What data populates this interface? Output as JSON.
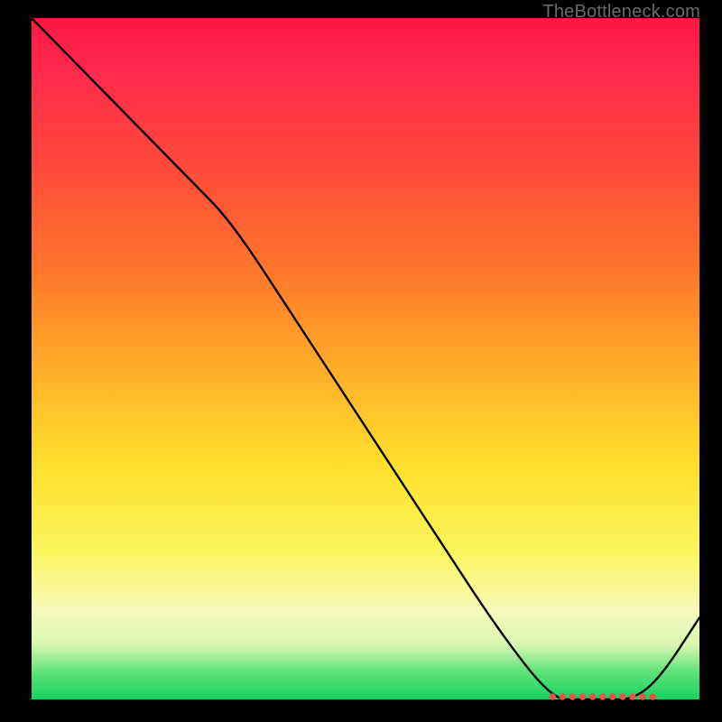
{
  "watermark": "TheBottleneck.com",
  "chart_data": {
    "type": "line",
    "title": "",
    "xlabel": "",
    "ylabel": "",
    "ylim": [
      0,
      100
    ],
    "xlim": [
      0,
      100
    ],
    "grid": false,
    "series": [
      {
        "name": "curve",
        "x": [
          0,
          8,
          16,
          24,
          30,
          40,
          50,
          60,
          70,
          78,
          82,
          86,
          90,
          94,
          100
        ],
        "values": [
          100,
          92,
          84,
          76,
          70,
          55,
          40,
          25,
          10,
          0,
          0,
          0,
          0,
          3,
          12
        ]
      }
    ],
    "annotations": {
      "valley_markers_x": [
        78,
        79.5,
        81,
        82.5,
        84,
        85.5,
        87,
        88.5,
        90,
        91.5,
        93
      ]
    },
    "description": "Single black curve over a vertical red→green heat gradient. Curve starts at top-left (y≈100), descends roughly linearly with a slight knee around x≈30, reaches y≈0 near x≈78, stays flat along the bottom to x≈93, then rises to y≈12 at x=100. A cluster of small red dots sits along the flat valley."
  }
}
